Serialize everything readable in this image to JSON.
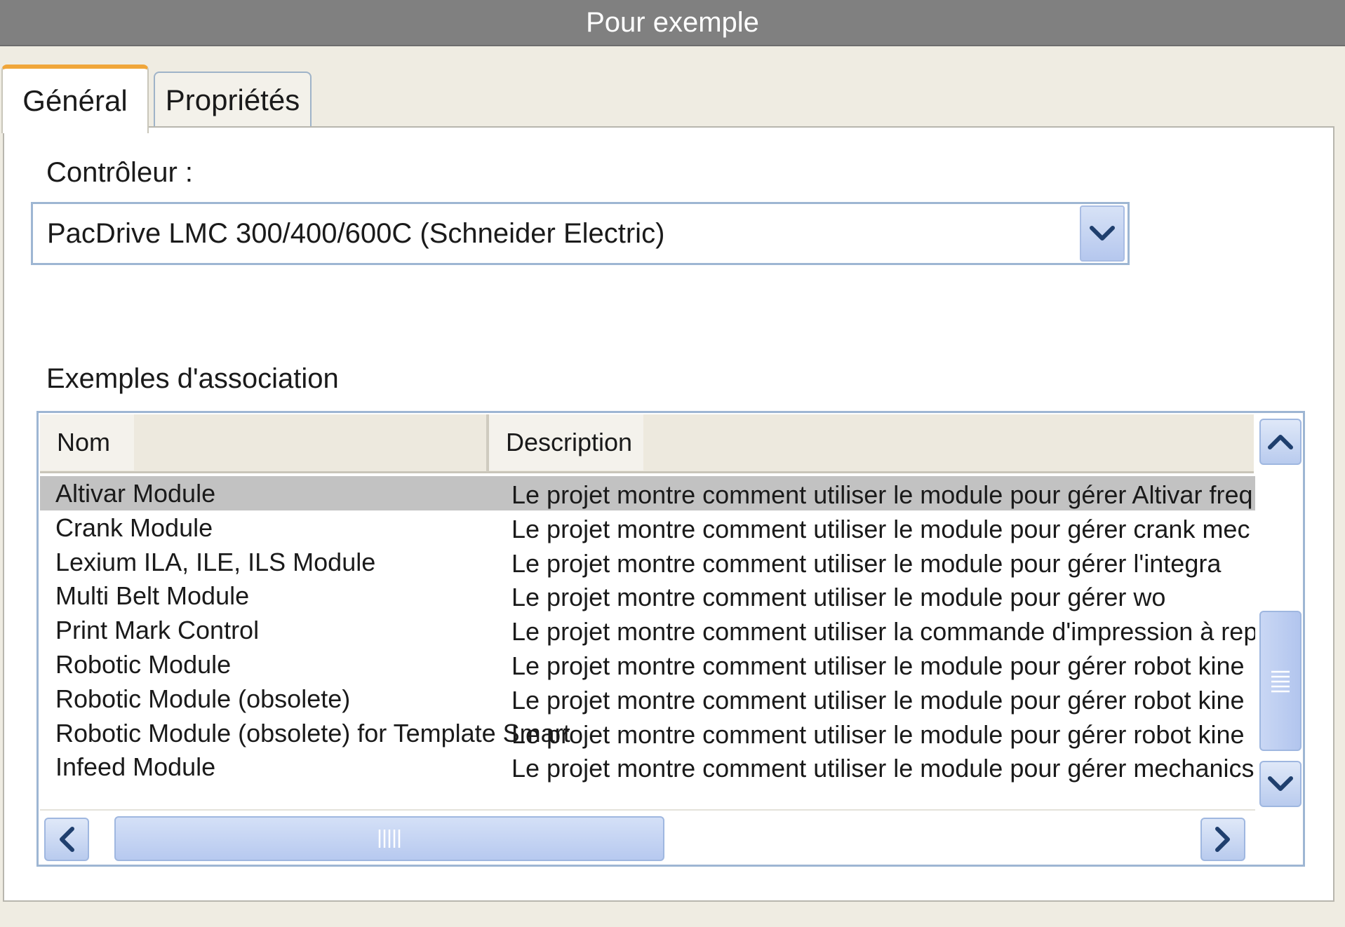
{
  "window": {
    "title": "Pour exemple"
  },
  "tabs": [
    {
      "label": "Général",
      "active": true
    },
    {
      "label": "Propriétés",
      "active": false
    }
  ],
  "controller": {
    "label": "Contrôleur :",
    "selected_value": "PacDrive LMC 300/400/600C (Schneider Electric)",
    "dropdown_icon": "chevron-down-icon"
  },
  "examples": {
    "label": "Exemples d'association",
    "columns": {
      "name": "Nom",
      "description": "Description"
    },
    "rows": [
      {
        "name": "Altivar Module",
        "description": "Le projet montre comment utiliser le module pour gérer Altivar freq",
        "selected": true
      },
      {
        "name": "Crank Module",
        "description": "Le projet montre comment utiliser le module pour gérer crank mec"
      },
      {
        "name": "Lexium ILA, ILE, ILS Module",
        "description": "Le projet montre comment utiliser le module pour gérer l'integra"
      },
      {
        "name": "Multi Belt Module",
        "description": "Le projet montre comment utiliser le module pour gérer wo"
      },
      {
        "name": "Print Mark Control",
        "description": "Le projet montre comment utiliser la commande d'impression à repères pour"
      },
      {
        "name": "Robotic Module",
        "description": "Le projet montre comment utiliser le module pour gérer robot kine"
      },
      {
        "name": "Robotic Module (obsolete)",
        "description": "Le projet montre comment utiliser le module pour gérer robot kine"
      },
      {
        "name": "Robotic Module (obsolete) for Template Smart",
        "description": "Le projet montre comment utiliser le module pour gérer robot kine"
      },
      {
        "name": "Infeed Module",
        "description": "Le projet montre comment utiliser le module pour gérer mechanics"
      }
    ]
  },
  "colors": {
    "titlebar": "#808080",
    "active_tab_accent": "#f0a63a",
    "selected_row": "#c2c2c2",
    "control_border": "#9eb6d3",
    "scroll_button": "#b9cbee",
    "arrow": "#1f3f6e"
  }
}
